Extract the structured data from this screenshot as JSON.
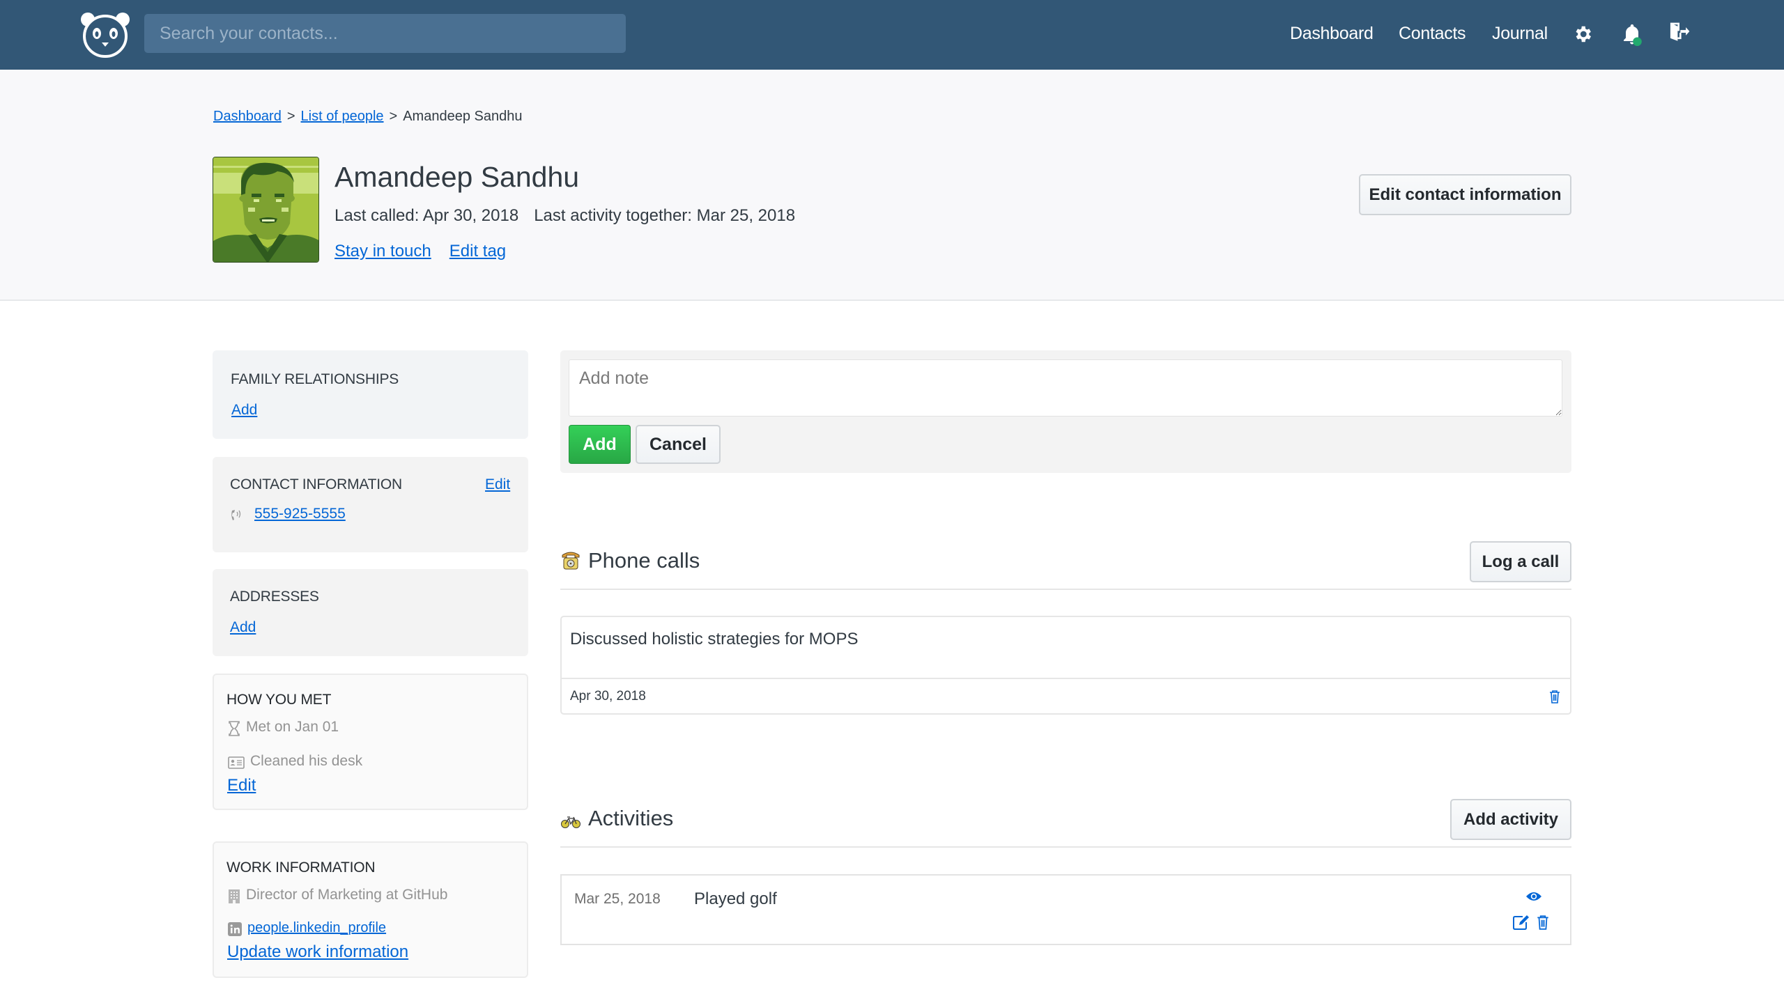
{
  "nav": {
    "logo_icon": "panda-logo-icon",
    "search_placeholder": "Search your contacts...",
    "links": [
      {
        "label": "Dashboard"
      },
      {
        "label": "Contacts"
      },
      {
        "label": "Journal"
      }
    ],
    "icons": [
      "gear-icon",
      "bell-icon",
      "logout-icon"
    ],
    "notification_dot_color": "#22a96e",
    "bar_color": "#325776"
  },
  "breadcrumb": {
    "items": [
      {
        "label": "Dashboard",
        "link": true
      },
      {
        "label": "List of people",
        "link": true
      },
      {
        "label": "Amandeep Sandhu",
        "link": false
      }
    ],
    "separator": ">"
  },
  "profile": {
    "name": "Amandeep Sandhu",
    "last_called": "Last called: Apr 30, 2018",
    "last_activity": "Last activity together: Mar 25, 2018",
    "stay_in_touch": "Stay in touch",
    "edit_tag": "Edit tag",
    "edit_contact_button": "Edit contact information"
  },
  "sidebar": {
    "family": {
      "title": "Family relationships",
      "add": "Add"
    },
    "contact": {
      "title": "Contact information",
      "edit": "Edit",
      "phone": "555-925-5555",
      "phone_icon": "phone-icon"
    },
    "addresses": {
      "title": "Addresses",
      "add": "Add"
    },
    "how_met": {
      "title": "How you met",
      "met_on": "Met on Jan 01",
      "met_on_icon": "hourglass-icon",
      "description": "Cleaned his desk",
      "description_icon": "id-card-icon",
      "edit": "Edit"
    },
    "work": {
      "title": "Work information",
      "job": "Director of Marketing at GitHub",
      "job_icon": "building-icon",
      "linkedin": "people.linkedin_profile",
      "linkedin_icon": "linkedin-icon",
      "update": "Update work information"
    }
  },
  "note": {
    "placeholder": "Add note",
    "add_button": "Add",
    "cancel_button": "Cancel"
  },
  "calls": {
    "title": "Phone calls",
    "icon": "telephone-icon",
    "log_button": "Log a call",
    "items": [
      {
        "content": "Discussed holistic strategies for MOPS",
        "date": "Apr 30, 2018"
      }
    ]
  },
  "activities": {
    "title": "Activities",
    "icon": "bicycle-icon",
    "add_button": "Add activity",
    "items": [
      {
        "date": "Mar 25, 2018",
        "title": "Played golf"
      }
    ]
  },
  "colors": {
    "link": "#0366d6",
    "primary_green": "#28a745",
    "header_bg": "#f8f8fa"
  }
}
